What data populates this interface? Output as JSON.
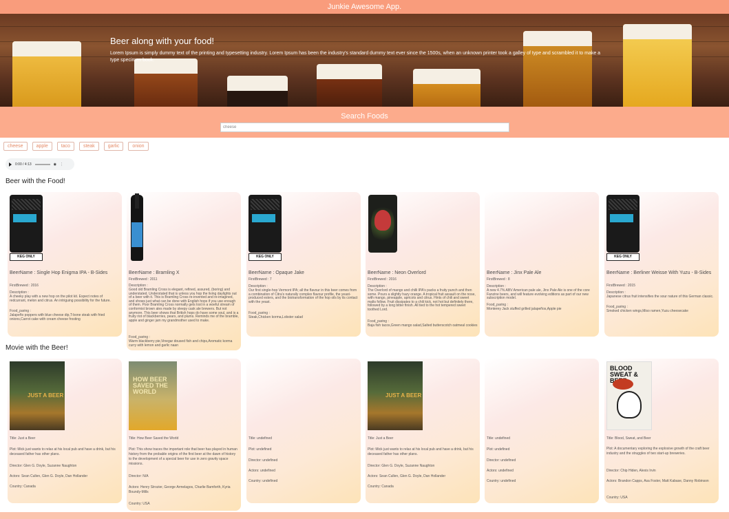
{
  "app_title": "Junkie Awesome App.",
  "hero": {
    "title": "Beer along with your food!",
    "text": "Lorem Ipsum is simply dummy text of the printing and typesetting industry. Lorem Ipsum has been the industry's standard dummy text ever since the 1500s, when an unknown printer took a galley of type and scrambled it to make a type specimen book."
  },
  "search": {
    "title": "Search Foods",
    "value": "cheese"
  },
  "chips": [
    "cheese",
    "apple",
    "taco",
    "steak",
    "garlic",
    "onion"
  ],
  "audio": {
    "time": "0:00 / 4:13"
  },
  "beer_section_title": "Beer with the Food!",
  "movie_section_title": "Movie with the Beer!",
  "beers": [
    {
      "name": "BeerName : Single Hop Enigma IPA - B-Sides",
      "first_brewed": "FirstBrewed : 2016",
      "description_label": "Description :",
      "description": "A cheeky play with a new hop on the pilot kit. Expect notes of redcurrant, melon and citrus. An intriguing possibility for the future.",
      "food_label": "Food_paring :",
      "food": "Jalapeño poppers with blue cheese dip,T-bone steak with fried onions,Carrot cake with cream cheese frosting",
      "keg": "KEG ONLY",
      "image": "black-can"
    },
    {
      "name": "BeerName : Bramling X",
      "first_brewed": "FirstBrewed : 2011",
      "description_label": "Description :",
      "description": "Good old Bramling Cross is elegant, refined, assured, (boring) and understated. Understated that is unless you hop the living daylights out of a beer with it. This is Bramling Cross re-invented and re-imagined, and shows just what can be done with English hops if you use enough of them. Poor Bramling Cross normally gets lost in a woeful stream of conformist brown ales made by sleepy cask ale brewers. But not anymore. This beer shows that British hops do have some soul, and is a fruity riot of blackberries, pears, and plums. Reminds me of the bramble, apple and ginger jam my grandmother used to make.",
      "food_label": "Food_paring :",
      "food": "Warm blackberry pie,Vinegar doused fish and chips,Aromatic korma curry with lemon and garlic naan",
      "keg": "",
      "image": "bottle"
    },
    {
      "name": "BeerName : Opaque Jake",
      "first_brewed": "FirstBrewed : 7",
      "description_label": "Description :",
      "description": "Our first single-hop Vermont IPA; all the flavour in this beer comes from a combination of Citra's naturally complex flavour profile, the yeast-produced esters, and the biotransformation of the hop oils by its contact with the yeast.",
      "food_label": "Food_paring :",
      "food": "Steak,Chicken korma,Lobster salad",
      "keg": "KEG ONLY",
      "image": "black-can"
    },
    {
      "name": "BeerName : Neon Overlord",
      "first_brewed": "FirstBrewed : 2016",
      "description_label": "Description :",
      "description": "The Overlord of mango and chilli IPA's packs a fruity punch and then some. Pours a slightly hazy orange. A tropical fruit assault on the nose, with mango, pineapple, apricots and citrus. Hints of chili and sweet malts follow. Fruit dissipates to a chili kick, not hot but definitely there, followed by a long bitter finish. All tied to the hot tempered sweet toothed Lord.",
      "food_label": "Food_paring :",
      "food": "Baja fish tacos,Green mango salad,Salted butterscotch oatmeal cookies",
      "keg": "",
      "image": "skull-can"
    },
    {
      "name": "BeerName : Jinx Pale Ale",
      "first_brewed": "FirstBrewed : 8",
      "description_label": "Description :",
      "description": "A new 4.7% ABV American pale ale, Jinx Pale Ale is one of the core Fanzine beers, and will feature evolving editions as part of our new subscription model.",
      "food_label": "Food_paring :",
      "food": "Monterey Jack stuffed grilled jalapeños,Apple pie",
      "keg": "",
      "image": "none"
    },
    {
      "name": "BeerName : Berliner Weisse With Yuzu - B-Sides",
      "first_brewed": "FirstBrewed : 2015",
      "description_label": "Description :",
      "description": "Japanese citrus fruit intensifies the sour nature of this German classic.",
      "food_label": "Food_paring :",
      "food": "Smoked chicken wings,Miso ramen,Yuzu cheesecake",
      "keg": "KEG ONLY",
      "image": "black-can"
    }
  ],
  "movies": [
    {
      "title": "Title: Just a Beer",
      "plot": "Plot: Mick just wants to relax at his local pub and have a drink, but his deceased father has other plans.",
      "director": "Director: Glen G. Doyle, Suzanne Naughton",
      "actors": "Actors: Sean Cullen, Glen G. Doyle, Dan Hollander",
      "country": "Country: Canada",
      "poster": "just-a-beer",
      "poster_text": "JUST A BEER"
    },
    {
      "title": "Title: How Beer Saved the World",
      "plot": "Plot: This show traces the important role that beer has played in human history from the probable origins of the first beer at the dawn of history to the development of a special beer for use in zero gravity space missions.",
      "director": "Director: N/A",
      "actors": "Actors: Henry Strozier, George Armelagos, Charlie Bamforth, Kyria Boundy-Mills",
      "country": "Country: USA",
      "poster": "beer-saved",
      "poster_text": "HOW BEER SAVED THE WORLD"
    },
    {
      "title": "Title: undefined",
      "plot": "Plot: undefined",
      "director": "Director: undefined",
      "actors": "Actors: undefined",
      "country": "Country: undefined",
      "poster": "none",
      "poster_text": ""
    },
    {
      "title": "Title: Just a Beer",
      "plot": "Plot: Mick just wants to relax at his local pub and have a drink, but his deceased father has other plans.",
      "director": "Director: Glen G. Doyle, Suzanne Naughton",
      "actors": "Actors: Sean Cullen, Glen G. Doyle, Dan Hollander",
      "country": "Country: Canada",
      "poster": "just-a-beer",
      "poster_text": "JUST A BEER"
    },
    {
      "title": "Title: undefined",
      "plot": "Plot: undefined",
      "director": "Director: undefined",
      "actors": "Actors: undefined",
      "country": "Country: undefined",
      "poster": "none",
      "poster_text": ""
    },
    {
      "title": "Title: Blood, Sweat, and Beer",
      "plot": "Plot: A documentary exploring the explosive growth of the craft beer industry and the struggles of two start-up breweries.",
      "director": "Director: Chip Hiden, Alexis Irvin",
      "actors": "Actors: Brandon Capps, Asa Foster, Matt Kabase, Danny Robinson",
      "country": "Country: USA",
      "poster": "blood-sweat",
      "poster_text": "BLOOD SWEAT & BEER"
    }
  ],
  "colors": {
    "accent": "#f99c7c",
    "search_band": "#fcab8c",
    "chip_text": "#e58a66"
  }
}
